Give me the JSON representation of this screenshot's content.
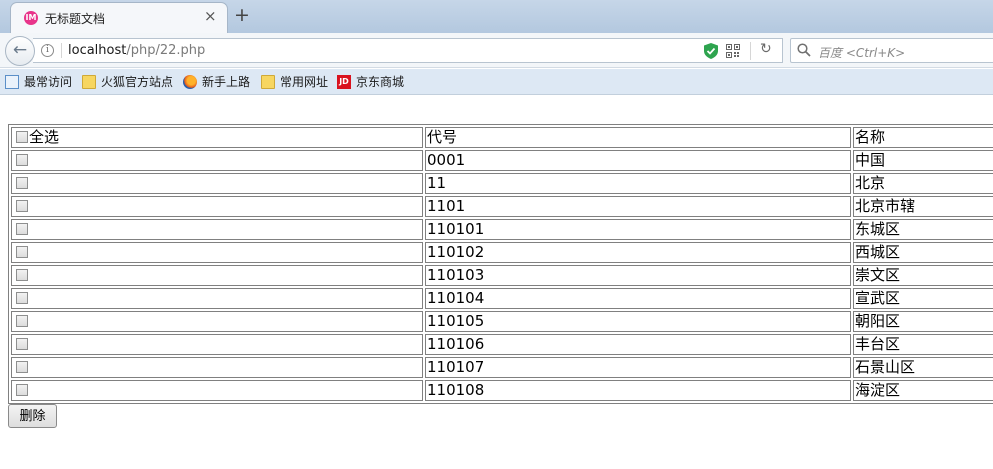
{
  "browser": {
    "tab": {
      "title": "无标题文档",
      "close": "×",
      "favicon": "IM"
    },
    "new_tab": "+",
    "url": {
      "host": "localhost",
      "path": "/php/22.php"
    },
    "info": "i",
    "reload": "↻",
    "back": "←",
    "search": {
      "placeholder": "百度 <Ctrl+K>"
    },
    "bookmarks": [
      {
        "label": "最常访问",
        "icon": "page-icon"
      },
      {
        "label": "火狐官方站点",
        "icon": "folder-icon"
      },
      {
        "label": "新手上路",
        "icon": "firefox-icon"
      },
      {
        "label": "常用网址",
        "icon": "folder-icon"
      },
      {
        "label": "京东商城",
        "icon": "jd-icon",
        "icon_text": "JD"
      }
    ]
  },
  "table": {
    "header": {
      "select_all": "全选",
      "code": "代号",
      "name": "名称"
    },
    "rows": [
      {
        "code": "0001",
        "name": "中国"
      },
      {
        "code": "11",
        "name": "北京"
      },
      {
        "code": "1101",
        "name": "北京市辖"
      },
      {
        "code": "110101",
        "name": "东城区"
      },
      {
        "code": "110102",
        "name": "西城区"
      },
      {
        "code": "110103",
        "name": "崇文区"
      },
      {
        "code": "110104",
        "name": "宣武区"
      },
      {
        "code": "110105",
        "name": "朝阳区"
      },
      {
        "code": "110106",
        "name": "丰台区"
      },
      {
        "code": "110107",
        "name": "石景山区"
      },
      {
        "code": "110108",
        "name": "海淀区"
      }
    ]
  },
  "delete_button": "删除",
  "colors": {
    "tabstrip": "#b3c8df",
    "bookmarks_bar": "#dde8f4",
    "favicon": "#e8348a",
    "jd_red": "#d9121f",
    "table_border": "#808080"
  }
}
